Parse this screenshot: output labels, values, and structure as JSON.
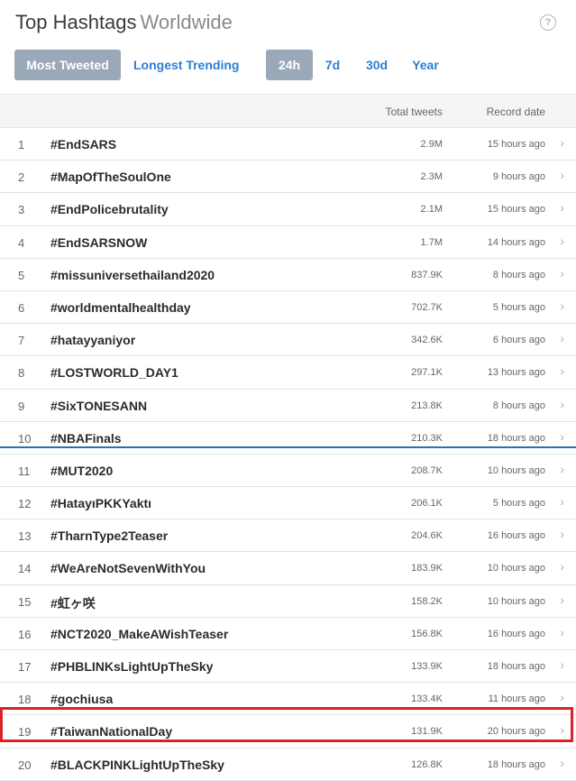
{
  "header": {
    "title": "Top Hashtags",
    "subtitle": "Worldwide",
    "help_icon": "?"
  },
  "tabs": {
    "most_tweeted": "Most Tweeted",
    "longest_trending": "Longest Trending"
  },
  "periods": {
    "h24": "24h",
    "d7": "7d",
    "d30": "30d",
    "year": "Year"
  },
  "table": {
    "col_total": "Total tweets",
    "col_date": "Record date",
    "rows": [
      {
        "rank": "1",
        "tag": "#EndSARS",
        "total": "2.9M",
        "date": "15 hours ago"
      },
      {
        "rank": "2",
        "tag": "#MapOfTheSoulOne",
        "total": "2.3M",
        "date": "9 hours ago"
      },
      {
        "rank": "3",
        "tag": "#EndPolicebrutality",
        "total": "2.1M",
        "date": "15 hours ago"
      },
      {
        "rank": "4",
        "tag": "#EndSARSNOW",
        "total": "1.7M",
        "date": "14 hours ago"
      },
      {
        "rank": "5",
        "tag": "#missuniversethailand2020",
        "total": "837.9K",
        "date": "8 hours ago"
      },
      {
        "rank": "6",
        "tag": "#worldmentalhealthday",
        "total": "702.7K",
        "date": "5 hours ago"
      },
      {
        "rank": "7",
        "tag": "#hatayyaniyor",
        "total": "342.6K",
        "date": "6 hours ago"
      },
      {
        "rank": "8",
        "tag": "#LOSTWORLD_DAY1",
        "total": "297.1K",
        "date": "13 hours ago"
      },
      {
        "rank": "9",
        "tag": "#SixTONESANN",
        "total": "213.8K",
        "date": "8 hours ago"
      },
      {
        "rank": "10",
        "tag": "#NBAFinals",
        "total": "210.3K",
        "date": "18 hours ago"
      },
      {
        "rank": "11",
        "tag": "#MUT2020",
        "total": "208.7K",
        "date": "10 hours ago"
      },
      {
        "rank": "12",
        "tag": "#HatayıPKKYaktı",
        "total": "206.1K",
        "date": "5 hours ago"
      },
      {
        "rank": "13",
        "tag": "#TharnType2Teaser",
        "total": "204.6K",
        "date": "16 hours ago"
      },
      {
        "rank": "14",
        "tag": "#WeAreNotSevenWithYou",
        "total": "183.9K",
        "date": "10 hours ago"
      },
      {
        "rank": "15",
        "tag": "#虹ヶ咲",
        "total": "158.2K",
        "date": "10 hours ago"
      },
      {
        "rank": "16",
        "tag": "#NCT2020_MakeAWishTeaser",
        "total": "156.8K",
        "date": "16 hours ago"
      },
      {
        "rank": "17",
        "tag": "#PHBLINKsLightUpTheSky",
        "total": "133.9K",
        "date": "18 hours ago"
      },
      {
        "rank": "18",
        "tag": "#gochiusa",
        "total": "133.4K",
        "date": "11 hours ago"
      },
      {
        "rank": "19",
        "tag": "#TaiwanNationalDay",
        "total": "131.9K",
        "date": "20 hours ago"
      },
      {
        "rank": "20",
        "tag": "#BLACKPINKLightUpTheSky",
        "total": "126.8K",
        "date": "18 hours ago"
      }
    ]
  },
  "colors": {
    "active_button": "#9aa9b8",
    "link": "#2a7fd4",
    "highlight": "#d9232a",
    "divider": "#2d6fb5"
  },
  "icons": {
    "help": "help-icon",
    "row_arrow": "chevron-right-icon"
  }
}
